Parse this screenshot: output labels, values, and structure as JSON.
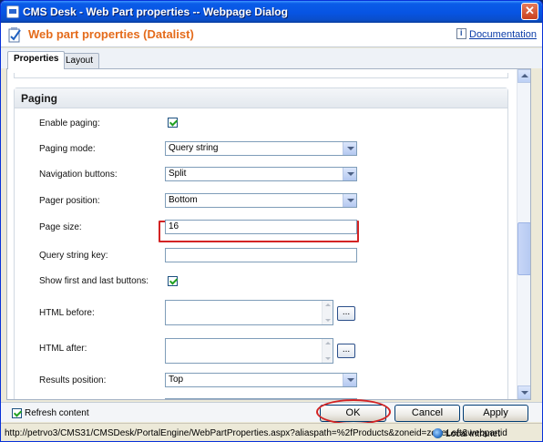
{
  "window": {
    "title": "CMS Desk - Web Part properties -- Webpage Dialog",
    "close_label": "✕"
  },
  "header": {
    "title": "Web part properties (Datalist)",
    "documentation_label": "Documentation"
  },
  "tabs": [
    {
      "label": "Properties",
      "active": true
    },
    {
      "label": "Layout",
      "active": false
    }
  ],
  "section": {
    "title": "Paging"
  },
  "fields": {
    "enable_paging": {
      "label": "Enable paging:",
      "checked": true
    },
    "paging_mode": {
      "label": "Paging mode:",
      "value": "Query string"
    },
    "navigation_buttons": {
      "label": "Navigation buttons:",
      "value": "Split"
    },
    "pager_position": {
      "label": "Pager position:",
      "value": "Bottom"
    },
    "page_size": {
      "label": "Page size:",
      "value": "16"
    },
    "query_string_key": {
      "label": "Query string key:",
      "value": ""
    },
    "show_first_last": {
      "label": "Show first and last buttons:",
      "checked": true
    },
    "html_before": {
      "label": "HTML before:",
      "button": "..."
    },
    "html_after": {
      "label": "HTML after:",
      "button": "..."
    },
    "results_position": {
      "label": "Results position:",
      "value": "Top"
    }
  },
  "footer": {
    "refresh_content": {
      "label": "Refresh content",
      "checked": true
    },
    "ok_label": "OK",
    "cancel_label": "Cancel",
    "apply_label": "Apply"
  },
  "statusbar": {
    "url": "http://petrvo3/CMS31/CMSDesk/PortalEngine/WebPartProperties.aspx?aliaspath=%2fProducts&zoneid=zoneLeft&webpartid",
    "zone": "Local intranet"
  },
  "colors": {
    "accent_title": "#e46b1b",
    "highlight": "#d32424",
    "link": "#0a3ca8"
  }
}
